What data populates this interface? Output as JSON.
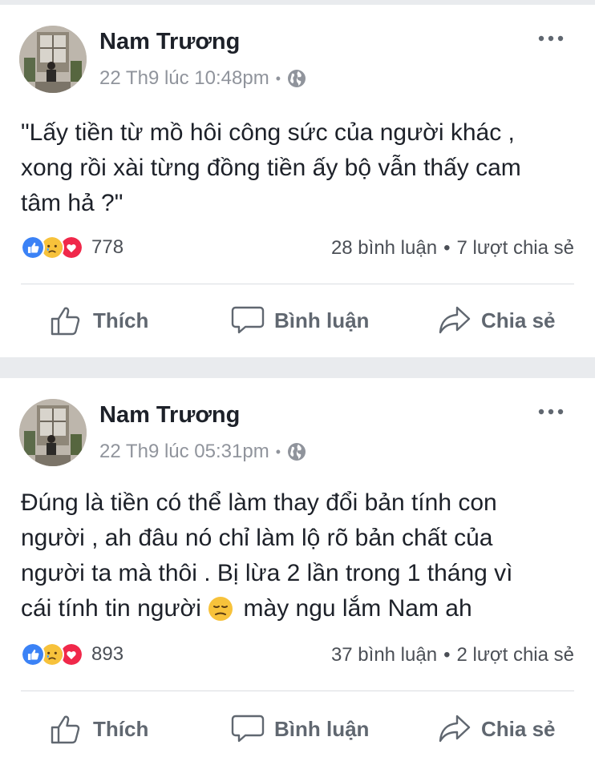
{
  "posts": [
    {
      "author": "Nam Trương",
      "timestamp": "22 Th9 lúc 10:48pm",
      "privacy_icon": "globe-icon",
      "text_lines": [
        "\"Lấy tiền từ mồ hôi công sức của người khác ,",
        "xong rồi xài từng đồng tiền ấy bộ vẫn thấy cam",
        "tâm hả ?\""
      ],
      "reaction_icons": [
        "like-icon",
        "sad-icon",
        "love-icon"
      ],
      "reaction_count": "778",
      "comments": "28 bình luận",
      "shares": "7 lượt chia sẻ"
    },
    {
      "author": "Nam Trương",
      "timestamp": "22 Th9 lúc 05:31pm",
      "privacy_icon": "globe-icon",
      "text_lines": [
        "Đúng là tiền có thể làm thay đổi bản tính con",
        "người , ah đâu nó chỉ làm lộ rõ bản chất của",
        "người ta mà thôi . Bị lừa 2 lần trong 1 tháng vì",
        "cái tính tin người ",
        " mày ngu lắm Nam ah"
      ],
      "reaction_icons": [
        "like-icon",
        "sad-icon",
        "love-icon"
      ],
      "reaction_count": "893",
      "comments": "37 bình luận",
      "shares": "2 lượt chia sẻ"
    }
  ],
  "stats_separator": "•",
  "meta_separator": "•",
  "actions": {
    "like": "Thích",
    "comment": "Bình luận",
    "share": "Chia sẻ"
  },
  "colors": {
    "like_blue": "#3b82f6",
    "love_red": "#f0284a",
    "sad_yellow": "#f7c23b",
    "meta_gray": "#90949c",
    "background": "#e9ebee"
  }
}
